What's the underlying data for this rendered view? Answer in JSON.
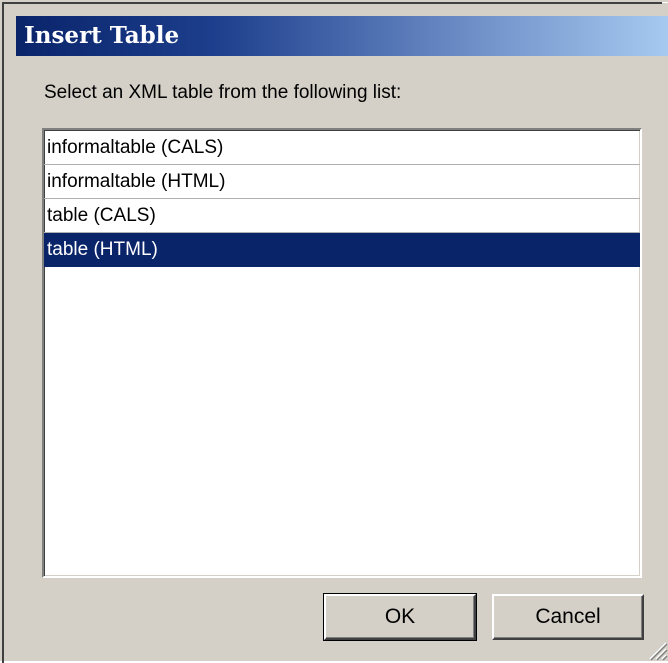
{
  "dialog": {
    "title": "Insert Table",
    "prompt": "Select an XML table from the following list:"
  },
  "list": {
    "items": [
      {
        "label": "informaltable (CALS)",
        "selected": false
      },
      {
        "label": "informaltable (HTML)",
        "selected": false
      },
      {
        "label": "table (CALS)",
        "selected": false
      },
      {
        "label": "table (HTML)",
        "selected": true
      }
    ]
  },
  "buttons": {
    "ok_label": "OK",
    "cancel_label": "Cancel"
  },
  "colors": {
    "title_gradient_start": "#0a246a",
    "title_gradient_end": "#a6caf0",
    "selection": "#0a246a",
    "face": "#d4d0c8"
  },
  "icons": {
    "resize_grip": "resize-grip-icon"
  }
}
